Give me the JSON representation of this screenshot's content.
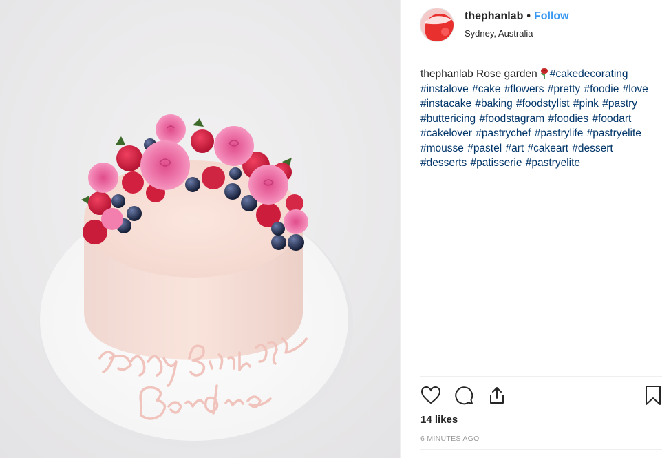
{
  "post": {
    "image_alt": "Cake with berries, roses and Happy Birthday Barbra piping",
    "cake_text_line1": "Happy Birthday",
    "cake_text_line2": "Barbra"
  },
  "header": {
    "username": "thephanlab",
    "separator": "•",
    "follow_label": "Follow",
    "location": "Sydney, Australia",
    "avatar_icon": "avatar-image"
  },
  "caption": {
    "username": "thephanlab",
    "text": "Rose garden",
    "emoji_icon": "rose-icon",
    "hashtags": "#cakedecorating #instalove #cake #flowers #pretty #foodie #love #instacake #baking #foodstylist #pink #pastry #buttericing #foodstagram #foodies #foodart #cakelover #pastrychef #pastrylife #pastryelite #mousse #pastel #art #cakeart #dessert #desserts #patisserie #pastryelite"
  },
  "actions": {
    "like_icon": "heart-icon",
    "comment_icon": "comment-icon",
    "share_icon": "share-icon",
    "save_icon": "bookmark-icon"
  },
  "stats": {
    "likes": "14 likes",
    "timestamp": "6 MINUTES AGO"
  },
  "colors": {
    "follow": "#3897f0",
    "hashtag": "#003569",
    "meta": "#999999",
    "text": "#262626"
  }
}
